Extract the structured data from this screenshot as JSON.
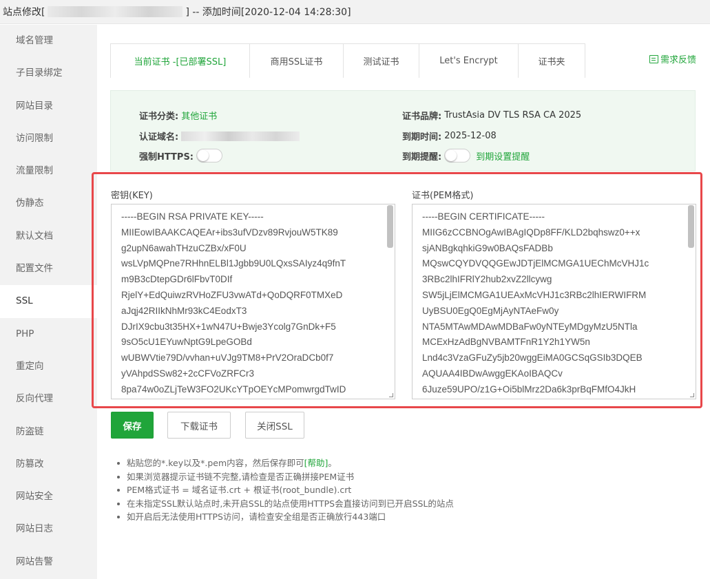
{
  "title": {
    "prefix": "站点修改[",
    "suffix": "] -- 添加时间[2020-12-04 14:28:30]"
  },
  "sidebar": {
    "items": [
      {
        "label": "域名管理"
      },
      {
        "label": "子目录绑定"
      },
      {
        "label": "网站目录"
      },
      {
        "label": "访问限制"
      },
      {
        "label": "流量限制"
      },
      {
        "label": "伪静态"
      },
      {
        "label": "默认文档"
      },
      {
        "label": "配置文件"
      },
      {
        "label": "SSL",
        "active": true
      },
      {
        "label": "PHP"
      },
      {
        "label": "重定向"
      },
      {
        "label": "反向代理"
      },
      {
        "label": "防盗链"
      },
      {
        "label": "防篡改"
      },
      {
        "label": "网站安全"
      },
      {
        "label": "网站日志"
      },
      {
        "label": "网站告警"
      }
    ]
  },
  "tabs": [
    {
      "label": "当前证书 -[已部署SSL]"
    },
    {
      "label": "商用SSL证书"
    },
    {
      "label": "测试证书"
    },
    {
      "label": "Let's Encrypt"
    },
    {
      "label": "证书夹"
    }
  ],
  "feedback": {
    "label": "需求反馈",
    "icon": "feedback-icon"
  },
  "cert_info": {
    "category_label": "证书分类:",
    "category_value": "其他证书",
    "brand_label": "证书品牌:",
    "brand_value": "TrustAsia DV TLS RSA CA 2025",
    "domain_label": "认证域名:",
    "expire_label": "到期时间:",
    "expire_value": "2025-12-08",
    "force_https_label": "强制HTTPS:",
    "force_https_on": false,
    "reminder_label": "到期提醒:",
    "reminder_on": false,
    "reminder_link": "到期设置提醒"
  },
  "key_field": {
    "label": "密钥(KEY)",
    "content": "-----BEGIN RSA PRIVATE KEY-----\nMIIEowIBAAKCAQEAr+ibs3ufVDzv89RvjouW5TK89\ng2upN6awahTHzuCZBx/xF0U\nwsLVpMQPne7RHhnELBl1Jgbb9U0LQxsSAIyz4q9fnT\nm9B3cDtepGDr6lFbvT0DIf\nRjelY+EdQuiwzRVHoZFU3vwATd+QoDQRF0TMXeD\naJqj42RIIkNhMr93kC4EodxT3\nDJrIX9cbu3t35HX+1wN47U+Bwje3Ycolg7GnDk+F5\n9sO5cU1EYuwNptG9LpeGOBd\nwUBWVtie79D/vvhan+uVJg9TM8+PrV2OraDCb0f7\nyVAhpdSSw82+2cCFVoZRFCr3\n8pa74w0oZLjTeW3FO2UKcYTpOEYcMPomwrgdTwID"
  },
  "cert_field": {
    "label": "证书(PEM格式)",
    "content": "-----BEGIN CERTIFICATE-----\nMIIG6zCCBNOgAwIBAgIQDp8FF/KLD2bqhswz0++x\nsjANBgkqhkiG9w0BAQsFADBb\nMQswCQYDVQQGEwJDTjElMCMGA1UEChMcVHJ1c\n3RBc2lhIFRlY2hub2xvZ2llcywg\nSW5jLjElMCMGA1UEAxMcVHJ1c3RBc2lhIERWIFRM\nUyBSU0EgQ0EgMjAyNTAeFw0y\nNTA5MTAwMDAwMDBaFw0yNTEyMDgyMzU5NTla\nMCExHzAdBgNVBAMTFnR1Y2h1YW5n\nLnd4c3VzaGFuZy5jb20wggEiMA0GCSqGSIb3DQEB\nAQUAA4IBDwAwggEKAoIBAQCv\n6Juze59UPO/z1G+Oi5blMrz2Da6k3prBqFMfO4JkH"
  },
  "buttons": {
    "save": "保存",
    "download": "下载证书",
    "close_ssl": "关闭SSL"
  },
  "notes": [
    {
      "text": "粘贴您的*.key以及*.pem内容，然后保存即可",
      "link": "[帮助]",
      "tail": "。"
    },
    {
      "text": "如果浏览器提示证书链不完整,请检查是否正确拼接PEM证书"
    },
    {
      "text": "PEM格式证书 = 域名证书.crt + 根证书(root_bundle).crt"
    },
    {
      "text": "在未指定SSL默认站点时,未开启SSL的站点使用HTTPS会直接访问到已开启SSL的站点"
    },
    {
      "text": "如开启后无法使用HTTPS访问，请检查安全组是否正确放行443端口"
    }
  ],
  "colors": {
    "accent": "#20a53a",
    "highlight": "#e8474a"
  }
}
